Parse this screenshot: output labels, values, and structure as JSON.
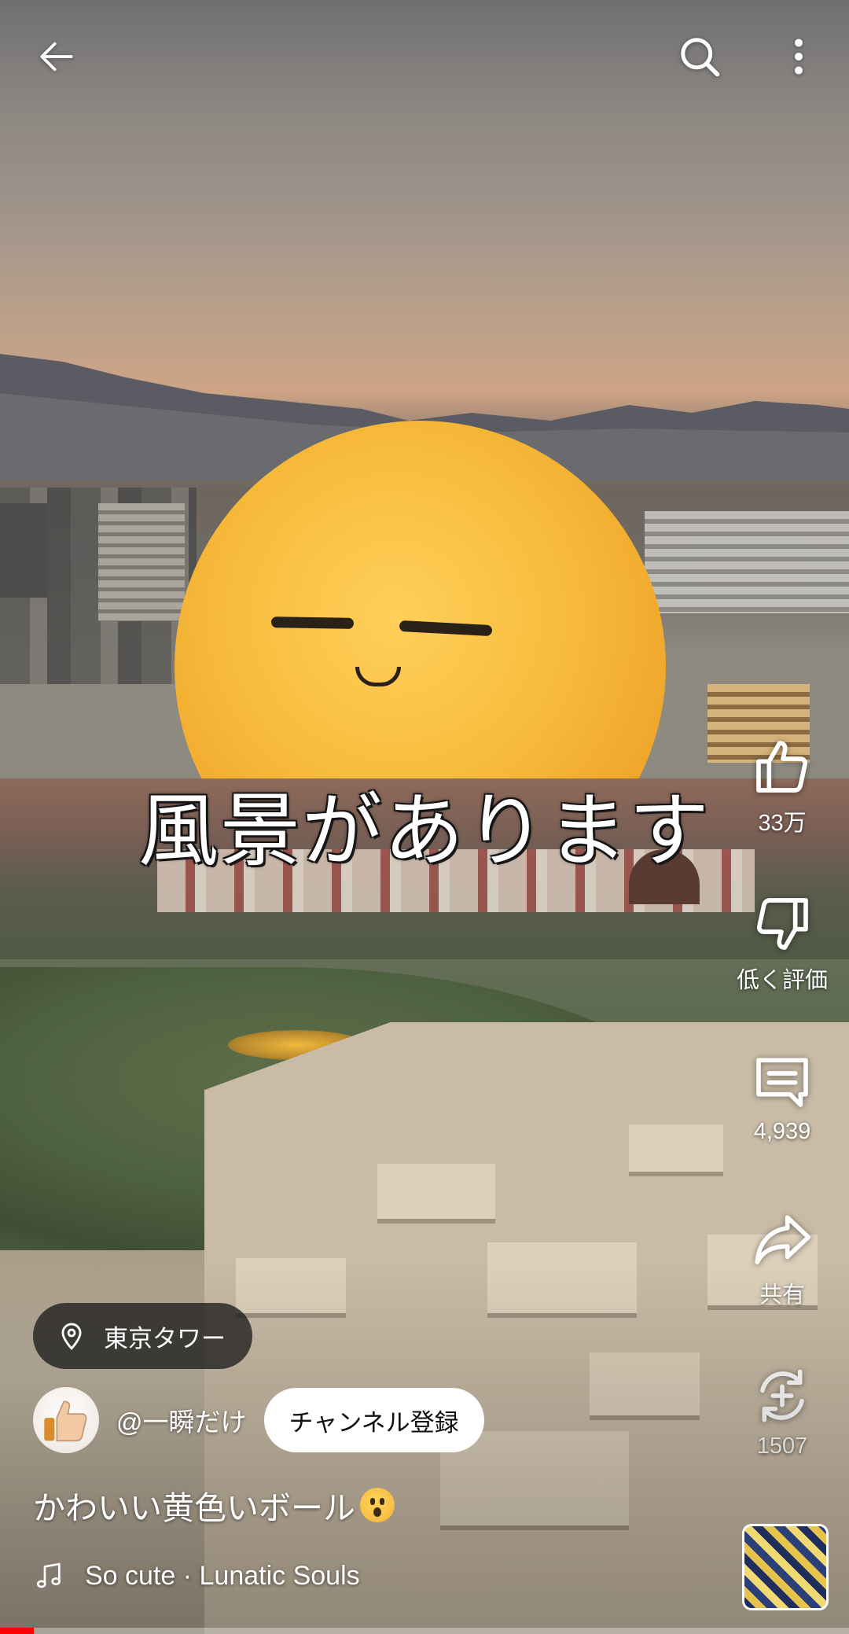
{
  "top_bar": {
    "back_icon": "arrow-left-icon",
    "search_icon": "search-icon",
    "more_icon": "more-vertical-icon"
  },
  "video": {
    "caption": "風景があります"
  },
  "actions": {
    "like": {
      "icon": "thumbs-up-icon",
      "label": "33万"
    },
    "dislike": {
      "icon": "thumbs-down-icon",
      "label": "低く評価"
    },
    "comments": {
      "icon": "comment-icon",
      "label": "4,939"
    },
    "share": {
      "icon": "share-icon",
      "label": "共有"
    },
    "remix": {
      "icon": "remix-icon",
      "label": "1507"
    }
  },
  "location": {
    "icon": "location-pin-icon",
    "label": "東京タワー"
  },
  "channel": {
    "name": "@一瞬だけ",
    "subscribe_label": "チャンネル登録"
  },
  "title": "かわいい黄色いボール",
  "title_emoji": "surprised-face-emoji",
  "music": {
    "icon": "music-note-icon",
    "label": "So cute · Lunatic Souls"
  },
  "progress": {
    "fraction": 0.04,
    "color": "#ff0000"
  },
  "colors": {
    "subscribe_bg": "#ffffff",
    "progress": "#ff0000"
  }
}
